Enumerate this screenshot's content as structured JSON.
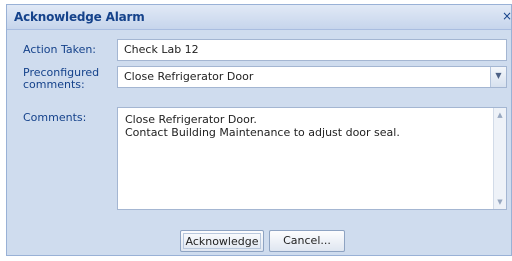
{
  "dialog": {
    "title": "Acknowledge Alarm",
    "close_icon": "×"
  },
  "form": {
    "action_taken": {
      "label": "Action Taken:",
      "value": "Check Lab 12"
    },
    "preconfigured": {
      "label_line1": "Preconfigured",
      "label_line2": "comments:",
      "value": "Close Refrigerator Door",
      "dropdown_icon": "▼"
    },
    "comments": {
      "label": "Comments:",
      "line1": "Close Refrigerator Door.",
      "line2": "Contact Building Maintenance to adjust door seal.",
      "scroll_up_icon": "▲",
      "scroll_down_icon": "▼"
    }
  },
  "buttons": {
    "acknowledge": "Acknowledge",
    "cancel": "Cancel..."
  }
}
